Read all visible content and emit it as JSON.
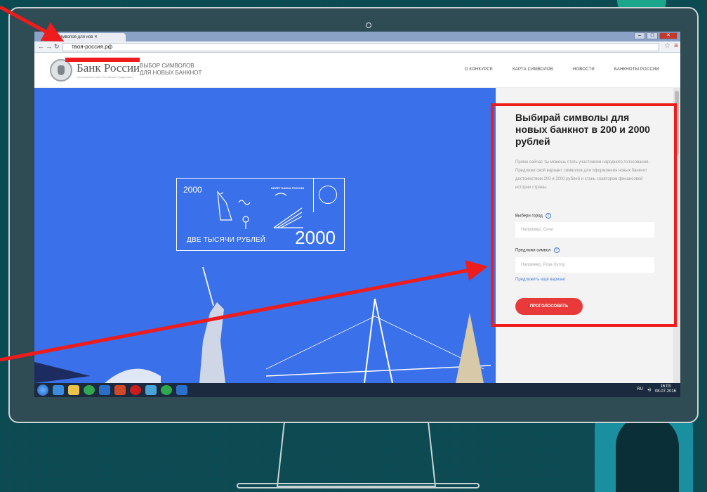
{
  "browser": {
    "tab_title": "имволов для нов ✕",
    "url": "твоя-россия.рф",
    "close_label": "✕"
  },
  "site": {
    "logo_title": "Банк России",
    "logo_subtitle": "Центральный банк Российской Федерации",
    "subtitle_line1": "ВЫБОР СИМВОЛОВ",
    "subtitle_line2": "ДЛЯ НОВЫХ БАНКНОТ",
    "nav": [
      "О КОНКУРСЕ",
      "КАРТА СИМВОЛОВ",
      "НОВОСТИ",
      "БАНКНОТЫ РОССИИ"
    ]
  },
  "banknote": {
    "denomination_small": "2000",
    "denomination_large": "2000",
    "header": "БИЛЕТ БАНКА РОССИИ",
    "text": "ДВЕ ТЫСЯЧИ РУБЛЕЙ"
  },
  "form": {
    "title": "Выбирай символы для новых банкнот в 200 и 2000 рублей",
    "description": "Прямо сейчас ты можешь стать участником народного голосования. Предложи свой вариант символов для оформления новых банкнот достоинством 200 и 2000 рублей и стань соавтором финансовой истории страны.",
    "city_label": "Выбери город",
    "city_placeholder": "Например, Сочи",
    "symbol_label": "Предложи символ",
    "symbol_placeholder": "Например, Роза Хутор",
    "suggest_link": "Предложить ещё вариант",
    "vote_button": "Проголосовать",
    "help_glyph": "?"
  },
  "taskbar": {
    "lang": "RU",
    "time": "16:03",
    "date": "08.07.2016"
  },
  "colors": {
    "hero_blue": "#3a70ea",
    "vote_red": "#e83a3a",
    "annotation_red": "#ee1c1c",
    "slide_bg": "#0d4a52"
  },
  "icons": [
    "back-icon",
    "forward-icon",
    "reload-icon",
    "star-icon",
    "menu-icon",
    "help-icon",
    "start-icon"
  ]
}
